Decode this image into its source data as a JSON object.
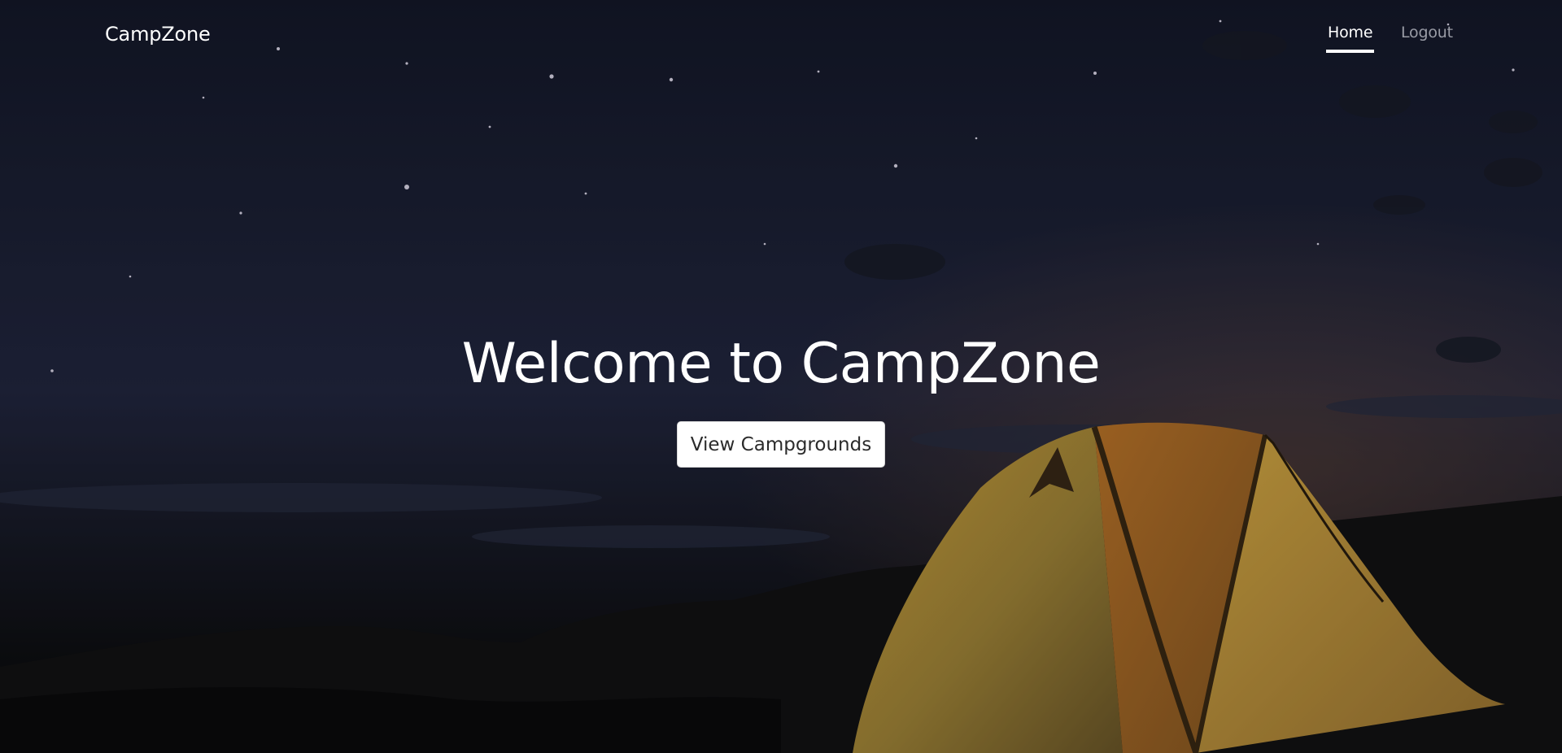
{
  "navbar": {
    "brand": "CampZone",
    "links": [
      {
        "label": "Home",
        "active": true
      },
      {
        "label": "Logout",
        "active": false
      }
    ]
  },
  "hero": {
    "title": "Welcome to CampZone",
    "button_label": "View Campgrounds",
    "background_image": "tent-under-night-sky"
  },
  "colors": {
    "text_primary": "#ffffff",
    "text_muted": "#9a9ca6",
    "button_bg": "#ffffff",
    "button_text": "#2b2b2b",
    "sky": "#232842",
    "tent_glow": "#c9a03a"
  }
}
